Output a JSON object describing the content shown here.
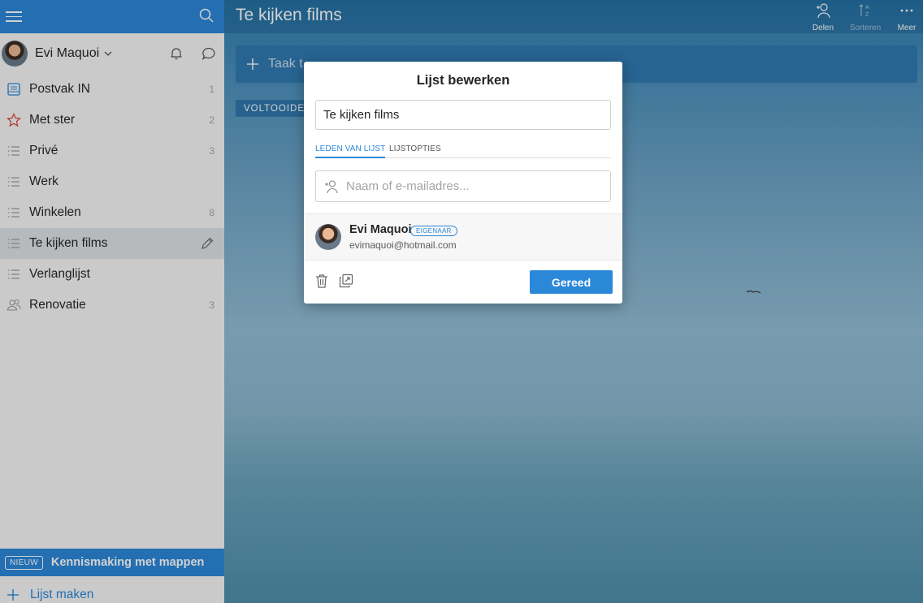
{
  "user": {
    "name": "Evi Maquoi"
  },
  "sidebar": {
    "lists": [
      {
        "label": "Postvak IN",
        "count": "1",
        "icon": "inbox-icon"
      },
      {
        "label": "Met ster",
        "count": "2",
        "icon": "star-icon"
      },
      {
        "label": "Privé",
        "count": "3",
        "icon": "list-icon"
      },
      {
        "label": "Werk",
        "count": "",
        "icon": "list-icon"
      },
      {
        "label": "Winkelen",
        "count": "8",
        "icon": "list-icon"
      },
      {
        "label": "Te kijken films",
        "count": "",
        "icon": "list-icon"
      },
      {
        "label": "Verlanglijst",
        "count": "",
        "icon": "list-icon"
      },
      {
        "label": "Renovatie",
        "count": "3",
        "icon": "shared-people-icon"
      }
    ],
    "promo": {
      "badge": "NIEUW",
      "text": "Kennismaking met mappen"
    },
    "create_label": "Lijst maken"
  },
  "main": {
    "title": "Te kijken films",
    "toolbar": {
      "share": "Delen",
      "sort": "Sorteren",
      "more": "Meer"
    },
    "add_task_placeholder": "Taak t",
    "completed_label": "VOLTOOIDE"
  },
  "modal": {
    "title": "Lijst bewerken",
    "list_name": "Te kijken films",
    "tabs": [
      "LEDEN VAN LIJST",
      "LIJSTOPTIES"
    ],
    "member_placeholder": "Naam of e-mailadres...",
    "member": {
      "name": "Evi Maquoi",
      "role": "EIGENAAR",
      "email": "evimaquoi@hotmail.com"
    },
    "done_label": "Gereed"
  },
  "colors": {
    "accent": "#2b88d9",
    "active_item_bg": "#dfe3e7",
    "sidebar_bg": "#f7f7f7"
  }
}
